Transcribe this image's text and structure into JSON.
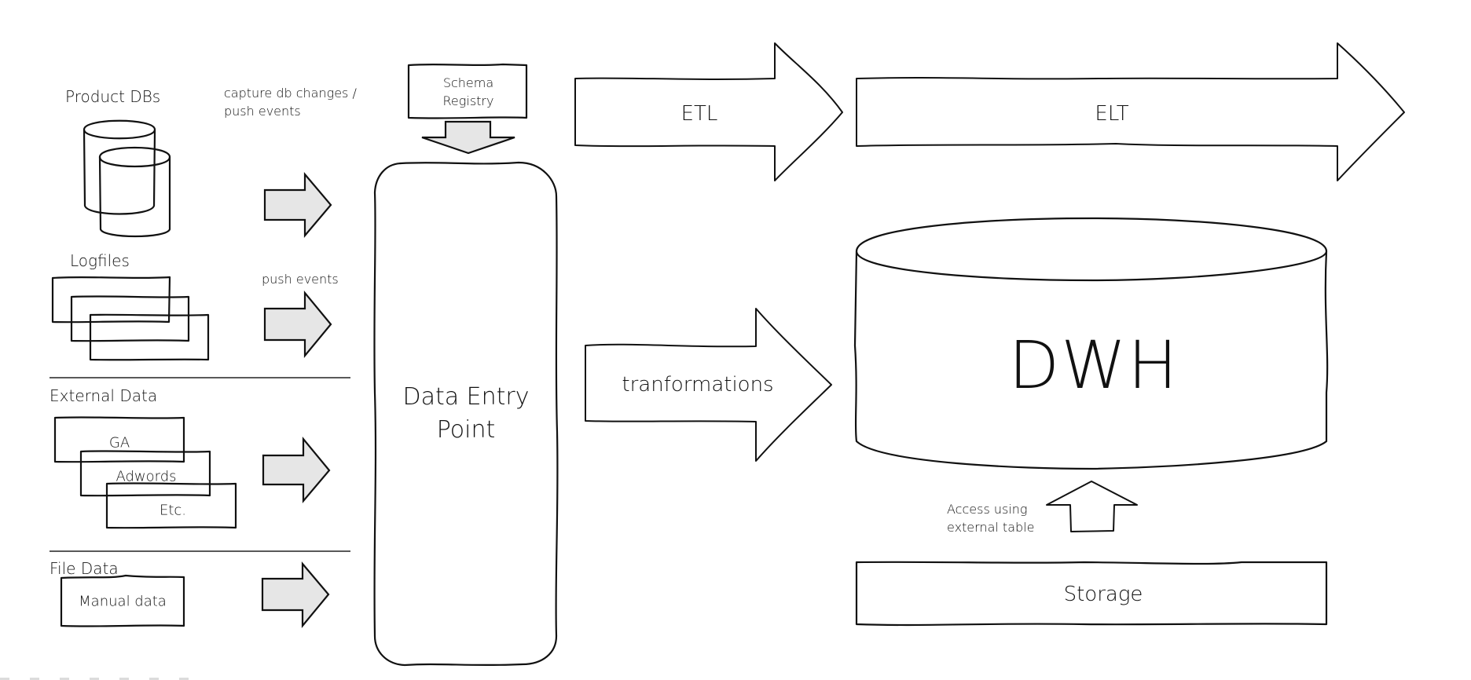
{
  "sources": {
    "product_dbs": {
      "label": "Product DBs",
      "icon": "database-icon"
    },
    "capture_note": {
      "line1": "capture db changes /",
      "line2": "push events"
    },
    "logfiles": {
      "label": "Logfiles",
      "icon": "files-icon"
    },
    "push_note": "push events",
    "external_data": {
      "label": "External Data",
      "items": [
        "GA",
        "Adwords",
        "Etc."
      ]
    },
    "file_data": {
      "label": "File Data",
      "items": [
        "Manual data"
      ]
    }
  },
  "schema_registry": {
    "line1": "Schema",
    "line2": "Registry"
  },
  "data_entry_point": {
    "line1": "Data Entry",
    "line2": "Point"
  },
  "flows": {
    "etl": "ETL",
    "elt": "ELT",
    "transformations": "tranformations"
  },
  "warehouse": {
    "label": "DWH"
  },
  "access_note": {
    "line1": "Access using",
    "line2": "external table"
  },
  "storage": {
    "label": "Storage"
  },
  "colors": {
    "arrow_fill": "#e6e6e6",
    "stroke": "#111111",
    "background": "#ffffff"
  }
}
